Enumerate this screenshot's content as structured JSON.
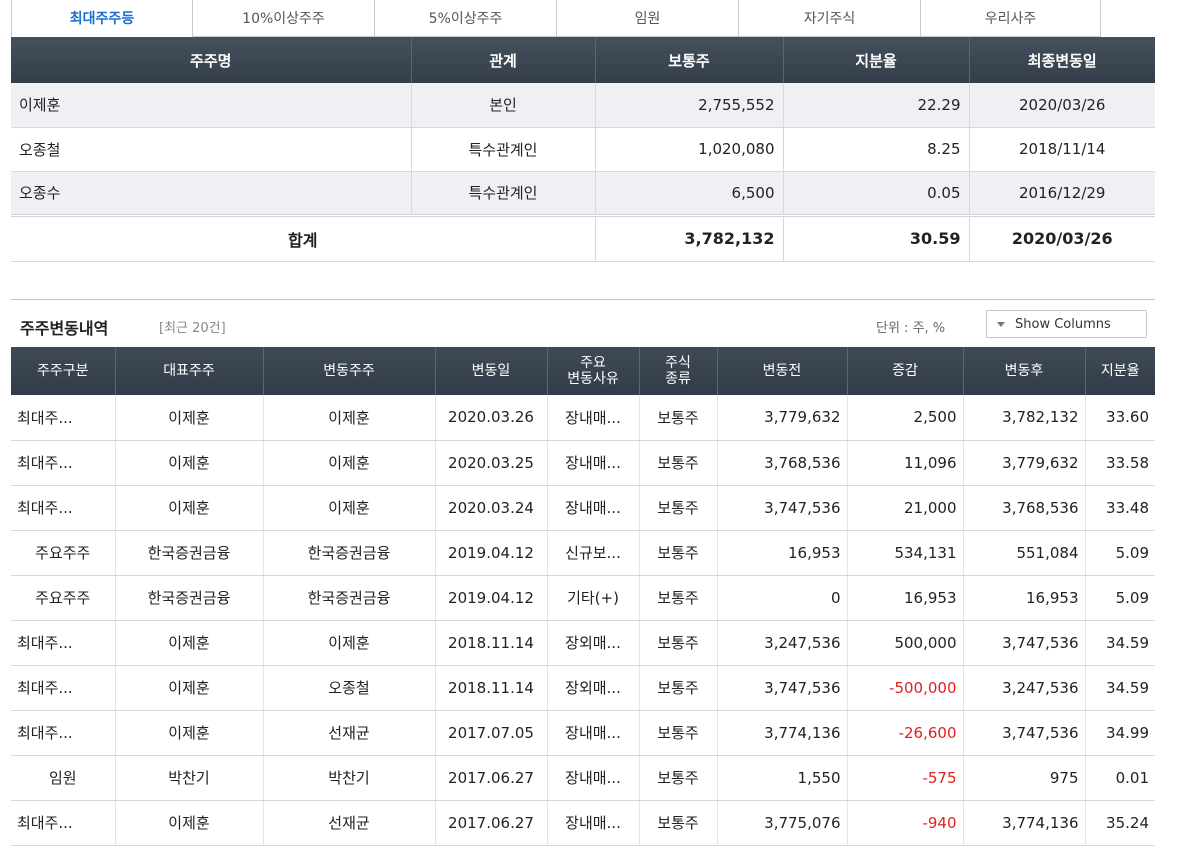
{
  "tabs": [
    {
      "label": "최대주주등",
      "active": true
    },
    {
      "label": "10%이상주주",
      "active": false
    },
    {
      "label": "5%이상주주",
      "active": false
    },
    {
      "label": "임원",
      "active": false
    },
    {
      "label": "자기주식",
      "active": false
    },
    {
      "label": "우리사주",
      "active": false
    }
  ],
  "major": {
    "headers": [
      "주주명",
      "관계",
      "보통주",
      "지분율",
      "최종변동일"
    ],
    "rows": [
      {
        "name": "이제훈",
        "relation": "본인",
        "shares": "2,755,552",
        "ratio": "22.29",
        "date": "2020/03/26"
      },
      {
        "name": "오종철",
        "relation": "특수관계인",
        "shares": "1,020,080",
        "ratio": "8.25",
        "date": "2018/11/14"
      },
      {
        "name": "오종수",
        "relation": "특수관계인",
        "shares": "6,500",
        "ratio": "0.05",
        "date": "2016/12/29"
      }
    ],
    "total": {
      "label": "합계",
      "shares": "3,782,132",
      "ratio": "30.59",
      "date": "2020/03/26"
    }
  },
  "history": {
    "title": "주주변동내역",
    "subtitle": "[최근 20건]",
    "unit": "단위 : 주, %",
    "show_columns": "Show Columns",
    "headers": [
      "주주구분",
      "대표주주",
      "변동주주",
      "변동일",
      "주요\n변동사유",
      "주식\n종류",
      "변동전",
      "증감",
      "변동후",
      "지분율"
    ],
    "rows": [
      {
        "type": "최대주...",
        "rep": "이제훈",
        "holder": "이제훈",
        "date": "2020.03.26",
        "reason": "장내매...",
        "kind": "보통주",
        "before": "3,779,632",
        "change": "2,500",
        "after": "3,782,132",
        "ratio": "33.60",
        "negative": false
      },
      {
        "type": "최대주...",
        "rep": "이제훈",
        "holder": "이제훈",
        "date": "2020.03.25",
        "reason": "장내매...",
        "kind": "보통주",
        "before": "3,768,536",
        "change": "11,096",
        "after": "3,779,632",
        "ratio": "33.58",
        "negative": false
      },
      {
        "type": "최대주...",
        "rep": "이제훈",
        "holder": "이제훈",
        "date": "2020.03.24",
        "reason": "장내매...",
        "kind": "보통주",
        "before": "3,747,536",
        "change": "21,000",
        "after": "3,768,536",
        "ratio": "33.48",
        "negative": false
      },
      {
        "type": "주요주주",
        "rep": "한국증권금융",
        "holder": "한국증권금융",
        "date": "2019.04.12",
        "reason": "신규보...",
        "kind": "보통주",
        "before": "16,953",
        "change": "534,131",
        "after": "551,084",
        "ratio": "5.09",
        "negative": false
      },
      {
        "type": "주요주주",
        "rep": "한국증권금융",
        "holder": "한국증권금융",
        "date": "2019.04.12",
        "reason": "기타(+)",
        "kind": "보통주",
        "before": "0",
        "change": "16,953",
        "after": "16,953",
        "ratio": "5.09",
        "negative": false
      },
      {
        "type": "최대주...",
        "rep": "이제훈",
        "holder": "이제훈",
        "date": "2018.11.14",
        "reason": "장외매...",
        "kind": "보통주",
        "before": "3,247,536",
        "change": "500,000",
        "after": "3,747,536",
        "ratio": "34.59",
        "negative": false
      },
      {
        "type": "최대주...",
        "rep": "이제훈",
        "holder": "오종철",
        "date": "2018.11.14",
        "reason": "장외매...",
        "kind": "보통주",
        "before": "3,747,536",
        "change": "-500,000",
        "after": "3,247,536",
        "ratio": "34.59",
        "negative": true
      },
      {
        "type": "최대주...",
        "rep": "이제훈",
        "holder": "선재균",
        "date": "2017.07.05",
        "reason": "장내매...",
        "kind": "보통주",
        "before": "3,774,136",
        "change": "-26,600",
        "after": "3,747,536",
        "ratio": "34.99",
        "negative": true
      },
      {
        "type": "임원",
        "rep": "박찬기",
        "holder": "박찬기",
        "date": "2017.06.27",
        "reason": "장내매...",
        "kind": "보통주",
        "before": "1,550",
        "change": "-575",
        "after": "975",
        "ratio": "0.01",
        "negative": true
      },
      {
        "type": "최대주...",
        "rep": "이제훈",
        "holder": "선재균",
        "date": "2017.06.27",
        "reason": "장내매...",
        "kind": "보통주",
        "before": "3,775,076",
        "change": "-940",
        "after": "3,774,136",
        "ratio": "35.24",
        "negative": true
      }
    ]
  },
  "colors": {
    "header_bg": "#3a4552",
    "tab_active": "#1b6fd1",
    "negative": "#e02020",
    "row_alt": "#eef0f3"
  }
}
